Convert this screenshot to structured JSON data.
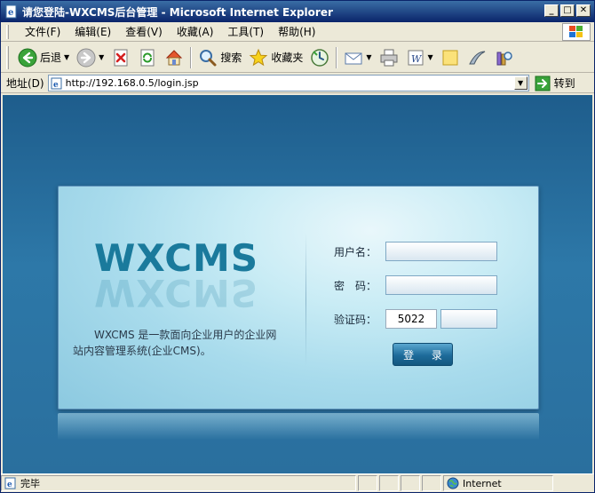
{
  "window": {
    "title": "请您登陆-WXCMS后台管理 - Microsoft Internet Explorer",
    "minimize": "_",
    "maximize": "□",
    "close": "✕"
  },
  "menu": {
    "items": [
      "文件(F)",
      "编辑(E)",
      "查看(V)",
      "收藏(A)",
      "工具(T)",
      "帮助(H)"
    ]
  },
  "toolbar": {
    "back_label": "后退",
    "search_label": "搜索",
    "favorites_label": "收藏夹"
  },
  "address": {
    "label": "地址(D)",
    "url": "http://192.168.0.5/login.jsp",
    "go_label": "转到"
  },
  "login": {
    "logo": "WXCMS",
    "description": "WXCMS 是一款面向企业用户的企业网站内容管理系统(企业CMS)。",
    "username_label": "用户名：",
    "password_label": "密　码：",
    "captcha_label": "验证码：",
    "captcha_code": "5022",
    "login_button": "登 录"
  },
  "status": {
    "text": "完毕",
    "zone": "Internet"
  }
}
